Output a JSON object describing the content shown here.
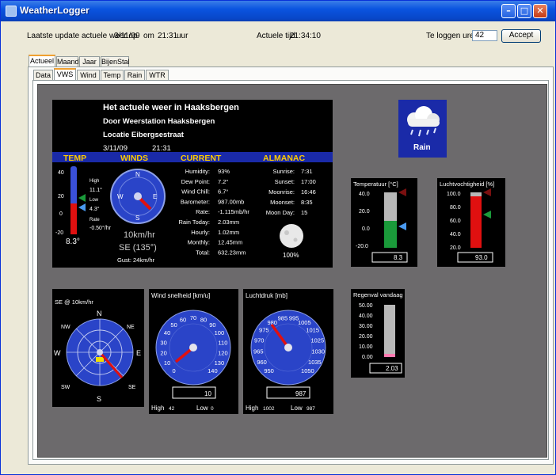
{
  "window": {
    "title": "WeatherLogger"
  },
  "header": {
    "update_label": "Laatste update actuele weer op",
    "update_date": "3/11/09",
    "om_label": "om",
    "update_time": "21:31",
    "uur_label": "uur",
    "actual_time_label": "Actuele tijd",
    "actual_time": "21:34:10",
    "log_hours_label": "Te loggen uren:",
    "log_hours_value": "42",
    "accept_label": "Accept"
  },
  "main_tabs": [
    "Actueel",
    "Maand",
    "Jaar",
    "BijenStal"
  ],
  "sub_tabs": [
    "Data",
    "VWS",
    "Wind",
    "Temp",
    "Rain",
    "WTR"
  ],
  "vws": {
    "title1": "Het actuele weer in Haaksbergen",
    "title2": "Door Weerstation Haaksbergen",
    "title3": "Locatie Eibergsestraat",
    "date": "3/11/09",
    "time": "21:31",
    "sections": [
      "TEMP",
      "WINDS",
      "CURRENT",
      "ALMANAC"
    ],
    "temp": {
      "scale": [
        "40",
        "20",
        "0",
        "-20"
      ],
      "high_label": "High",
      "high": "11.1°",
      "low_label": "Low",
      "low": "4.3°",
      "rate_label": "Rate",
      "rate": "-0.50°/hr",
      "current": "8.3°"
    },
    "wind": {
      "speed": "10km/hr",
      "dir": "SE (135°)",
      "gust": "Gust: 24km/hr",
      "n": "N",
      "s": "S",
      "e": "E",
      "w": "W"
    },
    "current": [
      [
        "Humidity:",
        "93%"
      ],
      [
        "Dew Point:",
        "7.2°"
      ],
      [
        "Wind Chill:",
        "6.7°"
      ],
      [
        "Barometer:",
        "987.00mb"
      ],
      [
        "Rate:",
        "-1.115mb/hr"
      ],
      [
        "Rain Today:",
        "2.03mm"
      ],
      [
        "Hourly:",
        "1.02mm"
      ],
      [
        "Monthly:",
        "12.45mm"
      ],
      [
        "Total:",
        "632.23mm"
      ]
    ],
    "almanac": [
      [
        "Sunrise:",
        "7:31"
      ],
      [
        "Sunset:",
        "17:00"
      ],
      [
        "Moonrise:",
        "16:46"
      ],
      [
        "Moonset:",
        "8:35"
      ],
      [
        "Moon Day:",
        "15"
      ]
    ],
    "moon_pct": "100%"
  },
  "weather_icon": {
    "label": "Rain"
  },
  "temperature_gauge": {
    "title": "Temperatuur [°C]",
    "scale": [
      "40.0",
      "20.0",
      "0.0",
      "-20.0"
    ],
    "value": "8.3"
  },
  "humidity_gauge": {
    "title": "Luchtvochtigheid [%]",
    "scale": [
      "100.0",
      "80.0",
      "60.0",
      "40.0",
      "20.0"
    ],
    "value": "93.0"
  },
  "rain_gauge": {
    "title": "Regenval vandaag",
    "scale": [
      "50.00",
      "40.00",
      "30.00",
      "20.00",
      "10.00",
      "0.00"
    ],
    "value": "2.03"
  },
  "windrose": {
    "title": "SE @ 10km/hr",
    "labels": [
      "N",
      "NE",
      "E",
      "SE",
      "S",
      "SW",
      "W",
      "NW"
    ]
  },
  "wind_speed_gauge": {
    "title": "Wind snelheid [km/u]",
    "ticks": [
      "0",
      "10",
      "20",
      "30",
      "40",
      "50",
      "60",
      "70",
      "80",
      "90",
      "100",
      "110",
      "120",
      "130",
      "140"
    ],
    "value": "10",
    "high_label": "High",
    "high": "42",
    "low_label": "Low",
    "low": "0"
  },
  "pressure_gauge": {
    "title": "Luchtdruk [mb]",
    "ticks": [
      "950",
      "960",
      "965",
      "970",
      "975",
      "980",
      "985",
      "995",
      "1005",
      "1015",
      "1025",
      "1030",
      "1035",
      "1050"
    ],
    "value": "987",
    "high_label": "High",
    "high": "1002",
    "low_label": "Low",
    "low": "987"
  },
  "colors": {
    "accent_blue": "#1a2aa8",
    "section_gold": "#ffcc00",
    "needle_red": "#e01010",
    "bar_green": "#1a9a3a",
    "bar_red": "#e01010"
  }
}
